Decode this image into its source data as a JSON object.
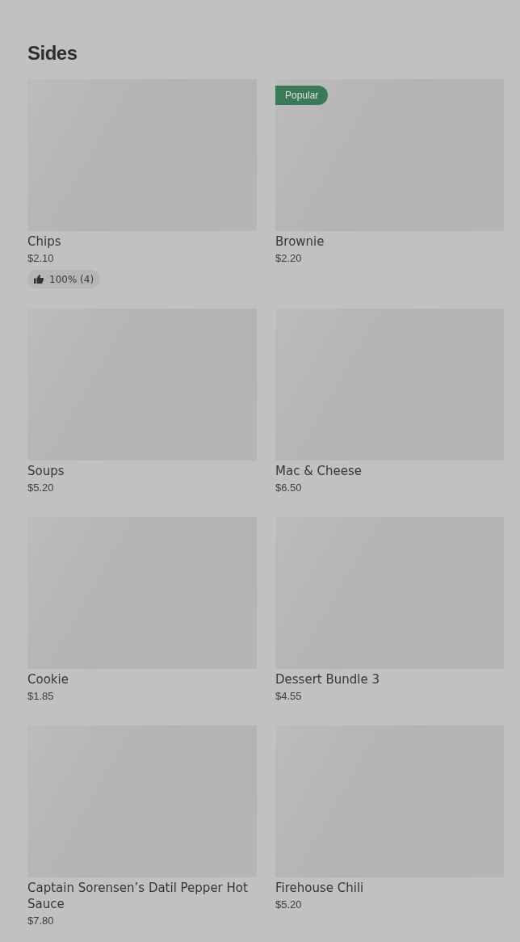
{
  "section": {
    "title": "Sides"
  },
  "rows": [
    {
      "cards": [
        {
          "name": "Chips",
          "price": "$2.10",
          "rating": "100% (4)"
        },
        {
          "name": "Brownie",
          "price": "$2.20",
          "badge": "Popular"
        }
      ]
    },
    {
      "cards": [
        {
          "name": "Soups",
          "price": "$5.20"
        },
        {
          "name": "Mac & Cheese",
          "price": "$6.50"
        }
      ]
    },
    {
      "cards": [
        {
          "name": "Cookie",
          "price": "$1.85"
        },
        {
          "name": "Dessert Bundle 3",
          "price": "$4.55"
        }
      ]
    },
    {
      "cards": [
        {
          "name": "Captain Sorensen’s Datil Pepper Hot Sauce",
          "price": "$7.80"
        },
        {
          "name": "Firehouse Chili",
          "price": "$5.20"
        }
      ]
    }
  ]
}
